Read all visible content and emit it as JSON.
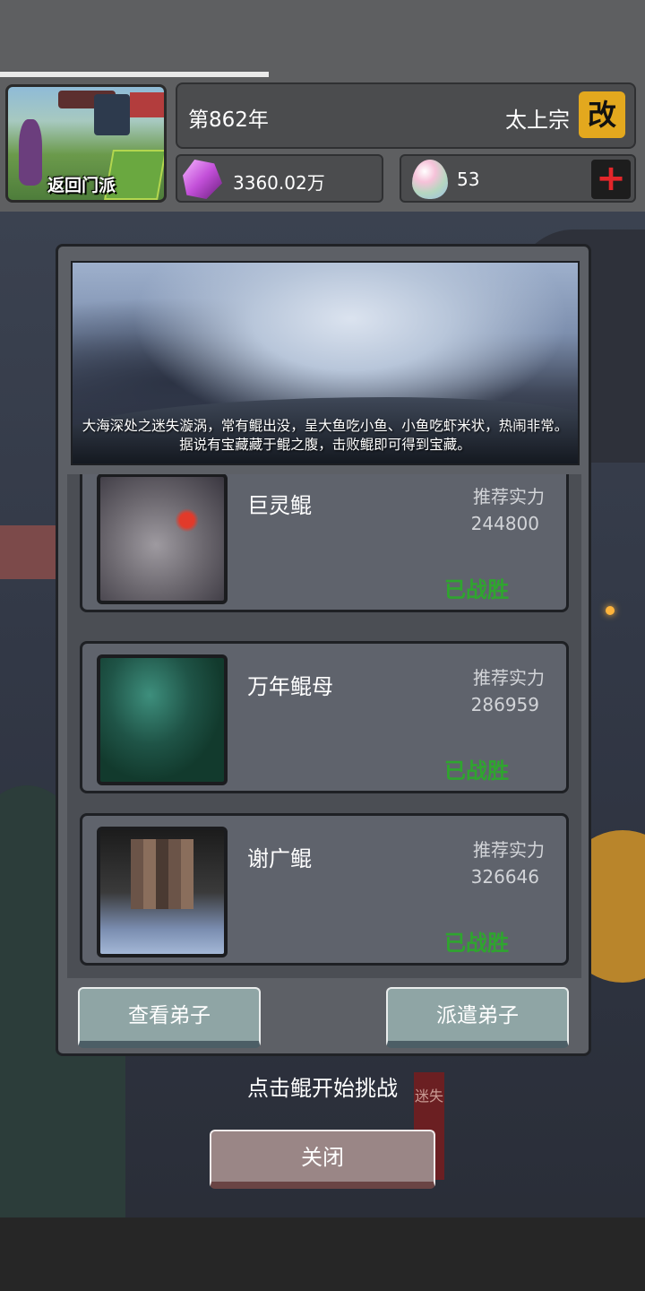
{
  "header": {
    "return_label": "返回门派",
    "year_text": "第862年",
    "sect_name": "太上宗",
    "rename_icon": "改",
    "crystal_amount": "3360.02万",
    "gem_amount": "53",
    "add_icon": "+"
  },
  "dialog": {
    "description": "大海深处之迷失漩涡，常有鲲出没，呈大鱼吃小鱼、小鱼吃虾米状，热闹非常。据说有宝藏藏于鲲之腹，击败鲲即可得到宝藏。",
    "enemies": [
      {
        "name": "巨灵鲲",
        "rec_label": "推荐实力",
        "rec_value": "244800",
        "status": "已战胜"
      },
      {
        "name": "万年鲲母",
        "rec_label": "推荐实力",
        "rec_value": "286959",
        "status": "已战胜"
      },
      {
        "name": "谢广鲲",
        "rec_label": "推荐实力",
        "rec_value": "326646",
        "status": "已战胜"
      }
    ],
    "view_disciples_label": "查看弟子",
    "send_disciples_label": "派遣弟子"
  },
  "hint": "点击鲲开始挑战",
  "close_label": "关闭",
  "background": {
    "banner_text": "迷失"
  },
  "colors": {
    "victory_green": "#2fa52f",
    "rename_gold": "#e3a81e",
    "add_red": "#e3262a"
  }
}
